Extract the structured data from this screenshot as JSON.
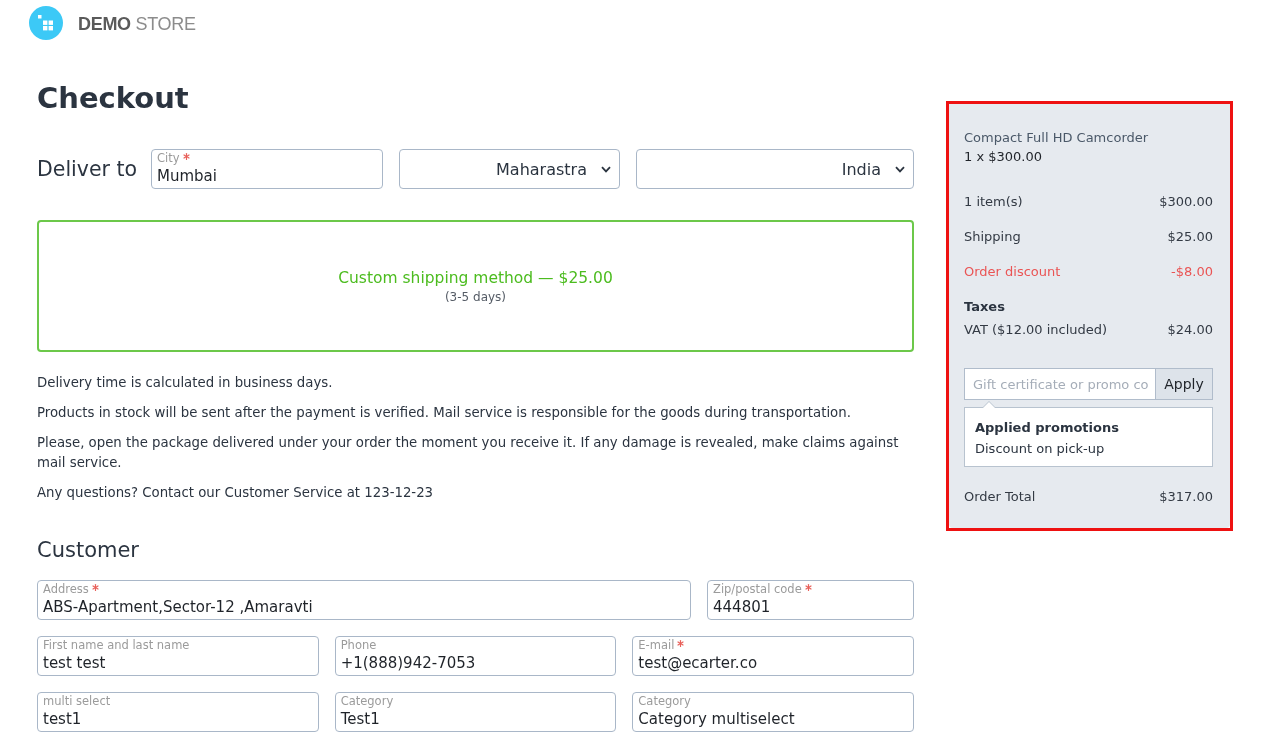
{
  "store_name": "**DEMO** STORE",
  "page_title": "Checkout",
  "delivery": {
    "label": "Deliver to",
    "city": {
      "label": "City",
      "required": true,
      "value": "Mumbai"
    },
    "state": {
      "value": "Maharastra"
    },
    "country": {
      "value": "India"
    }
  },
  "shipping_method": {
    "name": "Custom shipping method — $25.00",
    "note": "(3-5 days)",
    "selected": true
  },
  "info_paragraphs": [
    "Delivery time is calculated in business days.",
    "Products in stock will be sent after the payment is verified. Mail service is responsible for the goods during transportation.",
    "Please, open the package delivered under your order the moment you receive it. If any damage is revealed, make claims against mail service.",
    "Any questions? Contact our Customer Service at 123-12-23"
  ],
  "customer": {
    "title": "Customer",
    "rows": [
      {
        "fields": [
          {
            "label": "Address",
            "required": true,
            "value": "ABS-Apartment,Sector-12 ,Amaravti"
          },
          {
            "label": "Zip/postal code",
            "required": true,
            "value": "444801"
          }
        ]
      },
      {
        "fields": [
          {
            "label": "First name and last name",
            "required": false,
            "value": "test test"
          },
          {
            "label": "Phone",
            "required": false,
            "value": "+1(888)942-7053"
          },
          {
            "label": "E-mail",
            "required": true,
            "value": "test@ecarter.co"
          }
        ]
      },
      {
        "fields": [
          {
            "label": "multi select",
            "required": false,
            "value": "test1"
          },
          {
            "label": "Category",
            "required": false,
            "value": "Test1"
          },
          {
            "label": "Category",
            "required": false,
            "value": "Category multiselect"
          }
        ]
      }
    ]
  },
  "summary": {
    "highlighted": true,
    "product": {
      "name": "Compact Full HD Camcorder",
      "quantity_price": "1 x $300.00"
    },
    "lines": [
      {
        "kind": "normal",
        "label": "1 item(s)",
        "amount": "$300.00"
      },
      {
        "kind": "normal",
        "label": "Shipping",
        "amount": "$25.00"
      },
      {
        "kind": "discount",
        "label": "Order discount",
        "amount": "-$8.00"
      }
    ],
    "taxes": {
      "title": "Taxes",
      "lines": [
        {
          "label": "VAT ($12.00 included)",
          "amount": "$24.00"
        }
      ]
    },
    "promo": {
      "placeholder": "Gift certificate or promo co",
      "button": "Apply"
    },
    "applied_promotions": {
      "title": "Applied promotions",
      "items": [
        "Discount on pick-up"
      ]
    },
    "total": {
      "label": "Order Total",
      "amount": "$317.00"
    }
  }
}
